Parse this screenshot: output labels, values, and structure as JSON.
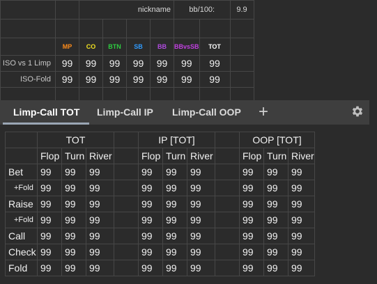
{
  "top": {
    "nickname_label": "nickname",
    "bb_label": "bb/100:",
    "bb_value": "9.9",
    "positions": [
      {
        "label": "MP",
        "color": "#ff8c1a"
      },
      {
        "label": "CO",
        "color": "#f0e020"
      },
      {
        "label": "BTN",
        "color": "#2ecc40"
      },
      {
        "label": "SB",
        "color": "#2f9bff"
      },
      {
        "label": "BB",
        "color": "#b04be0"
      },
      {
        "label": "BBvsSB",
        "color": "#c040e0"
      },
      {
        "label": "TOT",
        "color": "#ffffff"
      }
    ],
    "rows": [
      {
        "label": "ISO vs 1 Limp",
        "values": [
          "99",
          "99",
          "99",
          "99",
          "99",
          "99",
          "99"
        ]
      },
      {
        "label": "ISO-Fold",
        "values": [
          "99",
          "99",
          "99",
          "99",
          "99",
          "99",
          "99"
        ]
      }
    ]
  },
  "tabs": {
    "items": [
      "Limp-Call TOT",
      "Limp-Call IP",
      "Limp-Call OOP"
    ],
    "active_index": 0,
    "add_icon": "plus-icon",
    "settings_icon": "gear-icon"
  },
  "main": {
    "groups": [
      "TOT",
      "IP [TOT]",
      "OOP [TOT]"
    ],
    "streets": [
      "Flop",
      "Turn",
      "River"
    ],
    "street_colors": {
      "Flop": "#7fe8a8",
      "Turn": "#f1e889",
      "River": "#ff9d7a"
    },
    "rows": [
      {
        "label": "Bet",
        "values": [
          "99",
          "99",
          "99",
          "99",
          "99",
          "99",
          "99",
          "99",
          "99"
        ]
      },
      {
        "label": "+Fold",
        "values": [
          "99",
          "99",
          "99",
          "99",
          "99",
          "99",
          "99",
          "99",
          "99"
        ]
      },
      {
        "label": "Raise",
        "values": [
          "99",
          "99",
          "99",
          "99",
          "99",
          "99",
          "99",
          "99",
          "99"
        ]
      },
      {
        "label": "+Fold",
        "values": [
          "99",
          "99",
          "99",
          "99",
          "99",
          "99",
          "99",
          "99",
          "99"
        ]
      },
      {
        "label": "Call",
        "values": [
          "99",
          "99",
          "99",
          "99",
          "99",
          "99",
          "99",
          "99",
          "99"
        ]
      },
      {
        "label": "Check",
        "values": [
          "99",
          "99",
          "99",
          "99",
          "99",
          "99",
          "99",
          "99",
          "99"
        ]
      },
      {
        "label": "Fold",
        "values": [
          "99",
          "99",
          "99",
          "99",
          "99",
          "99",
          "99",
          "99",
          "99"
        ]
      }
    ]
  }
}
